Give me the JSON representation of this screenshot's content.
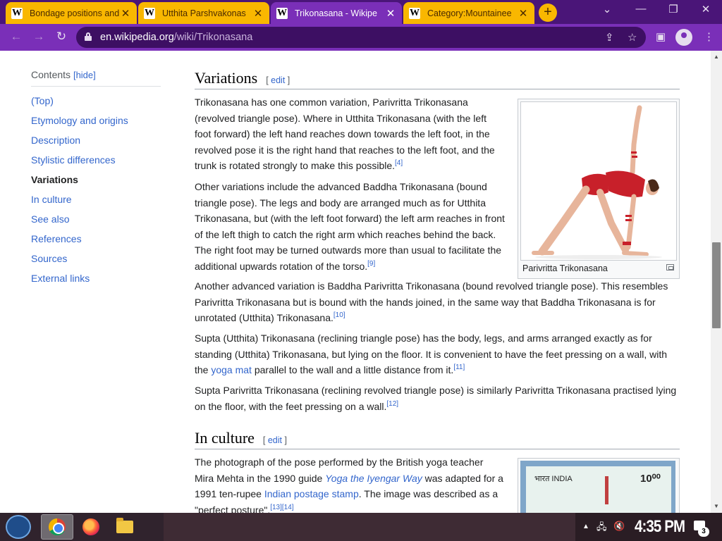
{
  "browser": {
    "tabs": [
      {
        "title": "Bondage positions and",
        "active": false
      },
      {
        "title": "Utthita Parshvakonas",
        "active": false
      },
      {
        "title": "Trikonasana - Wikipe",
        "active": true
      },
      {
        "title": "Category:Mountainee",
        "active": false
      }
    ],
    "favicon_letter": "W",
    "url_host": "en.wikipedia.org",
    "url_path": "/wiki/Trikonasana",
    "icons": {
      "back": "arrow-left-icon",
      "forward": "arrow-right-icon",
      "reload": "reload-icon",
      "lock": "lock-icon",
      "share": "share-icon",
      "star": "star-icon",
      "sidepanel": "side-panel-icon",
      "profile": "profile-icon",
      "menu": "kebab-menu-icon",
      "newtab": "plus-icon"
    },
    "colors": {
      "frame": "#4a1578",
      "toolbar": "#7a2fb8",
      "inactive_tab": "#f9b700"
    }
  },
  "toc": {
    "heading": "Contents",
    "hide_label": "hide",
    "items": [
      {
        "label": "(Top)",
        "current": false
      },
      {
        "label": "Etymology and origins",
        "current": false
      },
      {
        "label": "Description",
        "current": false
      },
      {
        "label": "Stylistic differences",
        "current": false
      },
      {
        "label": "Variations",
        "current": true
      },
      {
        "label": "In culture",
        "current": false
      },
      {
        "label": "See also",
        "current": false
      },
      {
        "label": "References",
        "current": false
      },
      {
        "label": "Sources",
        "current": false
      },
      {
        "label": "External links",
        "current": false
      }
    ]
  },
  "article": {
    "edit_label": "edit",
    "variations": {
      "heading": "Variations",
      "p1": "Trikonasana has one common variation, Parivritta Trikonasana (revolved triangle pose). Where in Utthita Trikonasana (with the left foot forward) the left hand reaches down towards the left foot, in the revolved pose it is the right hand that reaches to the left foot, and the trunk is rotated strongly to make this possible.",
      "p1_ref": "[4]",
      "p2": "Other variations include the advanced Baddha Trikonasana (bound triangle pose). The legs and body are arranged much as for Utthita Trikonasana, but (with the left foot forward) the left arm reaches in front of the left thigh to catch the right arm which reaches behind the back. The right foot may be turned outwards more than usual to facilitate the additional upwards rotation of the torso.",
      "p2_ref": "[9]",
      "p3": "Another advanced variation is Baddha Parivritta Trikonasana (bound revolved triangle pose). This resembles Parivritta Trikonasana but is bound with the hands joined, in the same way that Baddha Trikonasana is for unrotated (Utthita) Trikonasana.",
      "p3_ref": "[10]",
      "p4_a": "Supta (Utthita) Trikonasana (reclining triangle pose) has the body, legs, and arms arranged exactly as for standing (Utthita) Trikonasana, but lying on the floor. It is convenient to have the feet pressing on a wall, with the ",
      "p4_link": "yoga mat",
      "p4_b": " parallel to the wall and a little distance from it.",
      "p4_ref": "[11]",
      "p5": "Supta Parivritta Trikonasana (reclining revolved triangle pose) is similarly Parivritta Trikonasana practised lying on the floor, with the feet pressing on a wall.",
      "p5_ref": "[12]",
      "figure_caption": "Parivritta Trikonasana"
    },
    "culture": {
      "heading": "In culture",
      "p1_a": "The photograph of the pose performed by the British yoga teacher Mira Mehta in the 1990 guide ",
      "p1_link1": "Yoga the Iyengar Way",
      "p1_b": " was adapted for a 1991 ten-rupee ",
      "p1_link2": "Indian postage stamp",
      "p1_c": ". The image was described as a \"perfect posture\".",
      "p1_ref": "[13][14]",
      "stamp_country": "भारत INDIA",
      "stamp_value": "10⁰⁰"
    }
  },
  "taskbar": {
    "apps": [
      "windows-start",
      "chrome",
      "firefox",
      "file-explorer"
    ],
    "clock": "4:35 PM",
    "notification_count": "3"
  }
}
